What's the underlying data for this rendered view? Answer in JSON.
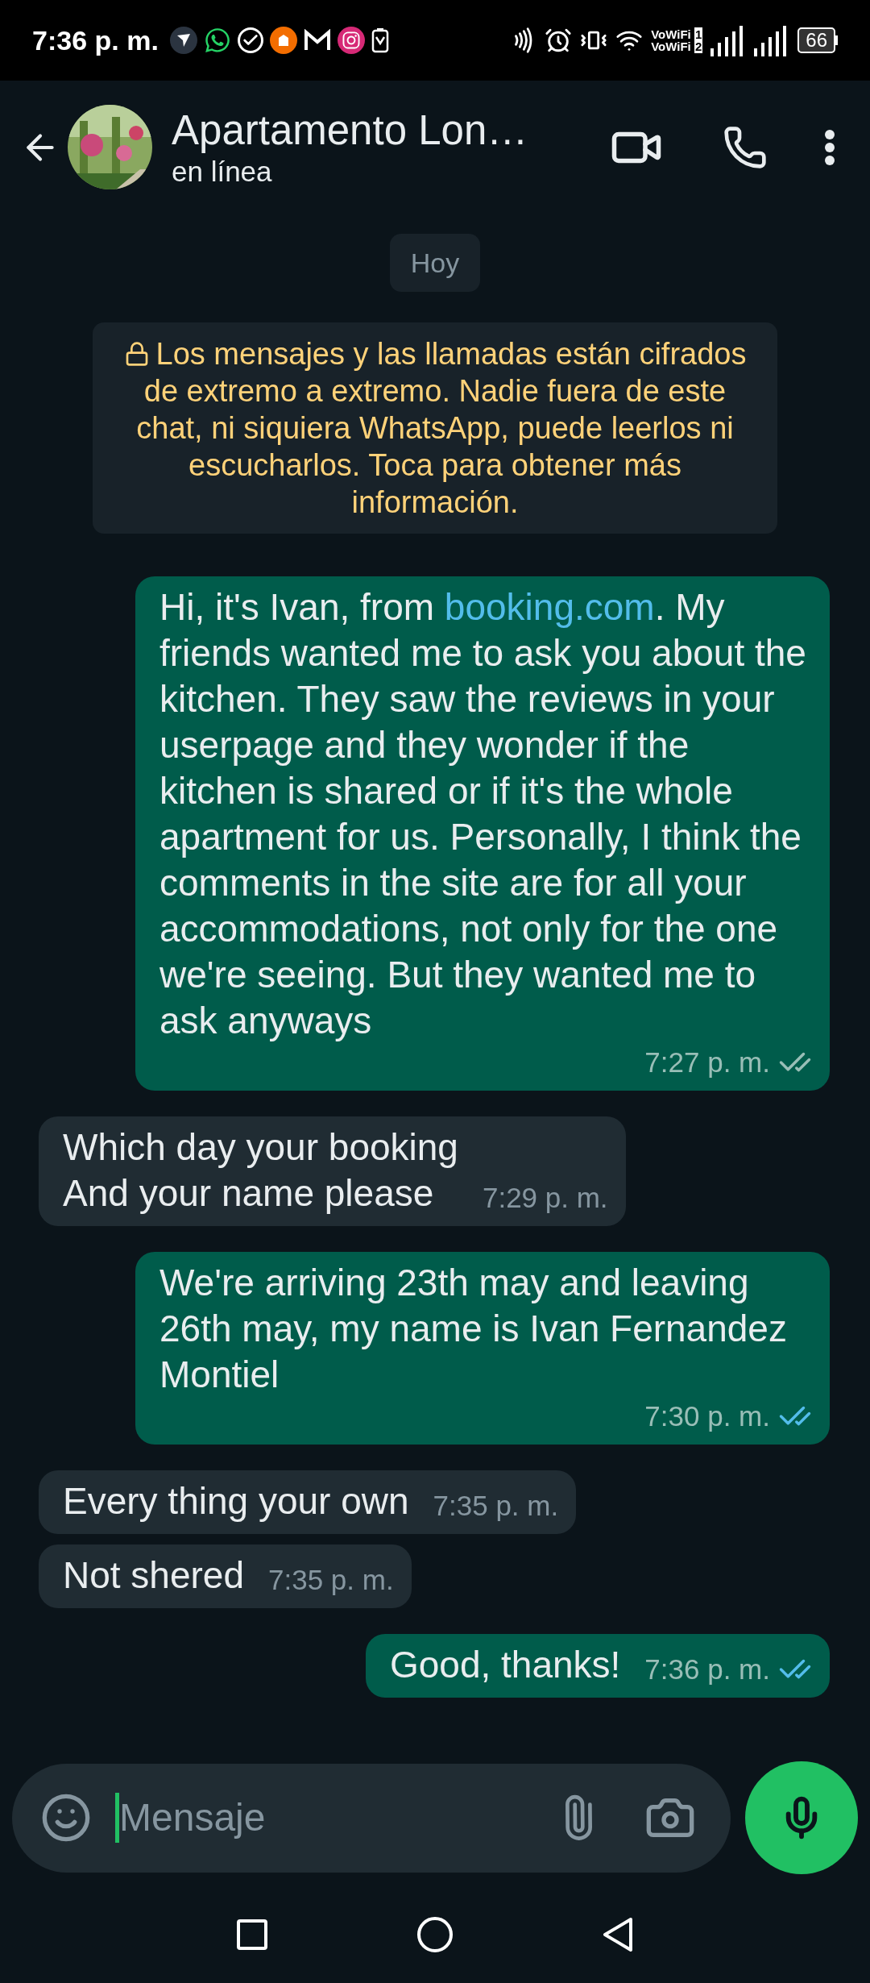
{
  "status_bar": {
    "time": "7:36 p. m.",
    "vowifi": [
      {
        "label": "VoWiFi",
        "sim": "1"
      },
      {
        "label": "VoWiFi",
        "sim": "2"
      }
    ],
    "battery": "66"
  },
  "header": {
    "title": "Apartamento Lon…",
    "status": "en línea"
  },
  "date_chip": "Hoy",
  "encryption_notice": "Los mensajes y las llamadas están cifrados de extremo a extremo. Nadie fuera de este chat, ni siquiera WhatsApp, puede leerlos ni escucharlos. Toca para obtener más información.",
  "messages": [
    {
      "kind": "sent",
      "parts": [
        {
          "kind": "text",
          "text": "Hi, it's Ivan, from "
        },
        {
          "kind": "link",
          "text": "booking.com"
        },
        {
          "kind": "text",
          "text": ". My friends wanted me to ask you about the kitchen. They saw the reviews in your userpage and they wonder if the kitchen is shared or if it's the whole apartment for us. Personally, I think the comments in the site are for all your accommodations, not only for the one we're seeing. But they wanted me to ask anyways"
        }
      ],
      "time": "7:27 p. m.",
      "read": false
    },
    {
      "kind": "received",
      "parts": [
        {
          "kind": "text",
          "text": "Which day your booking\nAnd your name please"
        }
      ],
      "time": "7:29 p. m."
    },
    {
      "kind": "sent",
      "parts": [
        {
          "kind": "text",
          "text": "We're arriving 23th may and leaving 26th may, my name is Ivan Fernandez Montiel"
        }
      ],
      "time": "7:30 p. m.",
      "read": true
    },
    {
      "kind": "received",
      "parts": [
        {
          "kind": "text",
          "text": "Every thing your own"
        }
      ],
      "time": "7:35 p. m."
    },
    {
      "kind": "received",
      "parts": [
        {
          "kind": "text",
          "text": "Not shered"
        }
      ],
      "time": "7:35 p. m."
    },
    {
      "kind": "sent",
      "parts": [
        {
          "kind": "text",
          "text": "Good, thanks!"
        }
      ],
      "time": "7:36 p. m.",
      "read": true
    }
  ],
  "composer": {
    "placeholder": "Mensaje"
  }
}
